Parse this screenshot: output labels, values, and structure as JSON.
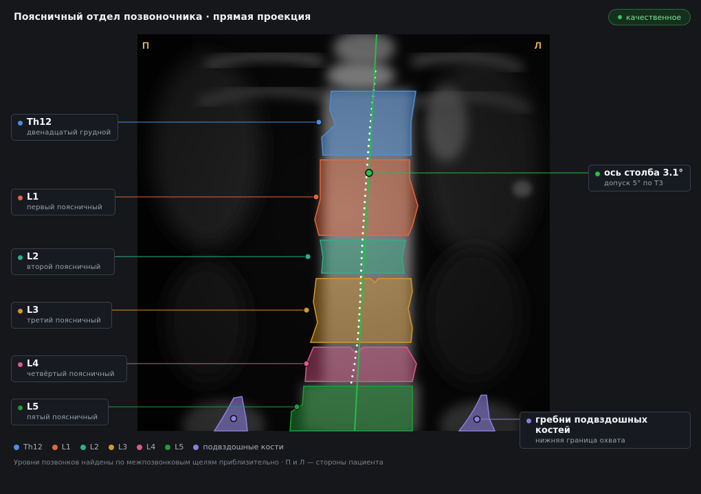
{
  "header": {
    "title": "Поясничный отдел позвоночника · прямая проекция",
    "quality_badge": "качественное"
  },
  "image": {
    "side_right": "П",
    "side_left": "Л"
  },
  "colors": {
    "Th12": "#4a90e2",
    "L1": "#e8663a",
    "L2": "#2bb08a",
    "L3": "#d9962a",
    "L4": "#e0588a",
    "L5": "#1e9e36",
    "iliac": "#8a7fe0",
    "axis": "#22c04a"
  },
  "callouts": [
    {
      "id": "Th12",
      "title": "Th12",
      "subtitle": "двенадцатый грудной"
    },
    {
      "id": "L1",
      "title": "L1",
      "subtitle": "первый поясничный"
    },
    {
      "id": "L2",
      "title": "L2",
      "subtitle": "второй поясничный"
    },
    {
      "id": "L3",
      "title": "L3",
      "subtitle": "третий поясничный"
    },
    {
      "id": "L4",
      "title": "L4",
      "subtitle": "четвёртый поясничный"
    },
    {
      "id": "L5",
      "title": "L5",
      "subtitle": "пятый поясничный"
    }
  ],
  "axis_callout": {
    "title": "ось столба 3.1°",
    "subtitle": "допуск 5° по Т3"
  },
  "iliac_callout": {
    "title": "гребни подвздошных костей",
    "subtitle": "нижняя граница охвата"
  },
  "legend": [
    {
      "label": "Th12",
      "color": "#4a90e2"
    },
    {
      "label": "L1",
      "color": "#e8663a"
    },
    {
      "label": "L2",
      "color": "#2bb08a"
    },
    {
      "label": "L3",
      "color": "#d9962a"
    },
    {
      "label": "L4",
      "color": "#e0588a"
    },
    {
      "label": "L5",
      "color": "#1e9e36"
    },
    {
      "label": "подвздошные кости",
      "color": "#8a7fe0"
    }
  ],
  "footnote": "Уровни позвонков найдены по межпозвонковым щелям приблизительно · П и Л — стороны пациента"
}
